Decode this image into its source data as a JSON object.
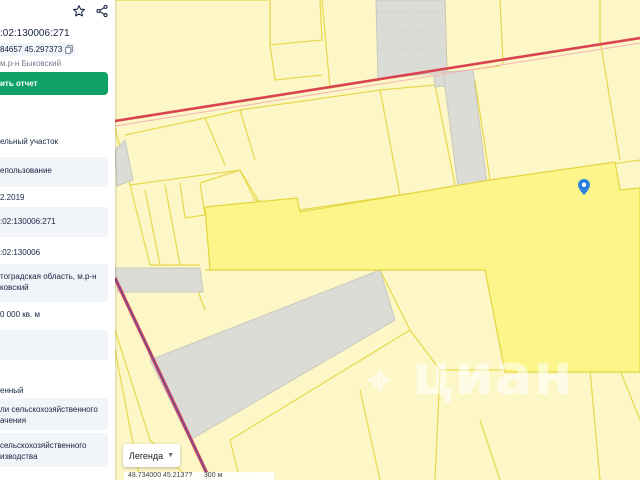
{
  "panel": {
    "title": ":02:130006:271",
    "coords": "84657 45.297373",
    "district": "м.р-н Быковский",
    "report_button": "ить отчет",
    "rows": [
      {
        "lines": [
          "ельный участок"
        ]
      },
      {
        "lines": [
          "епользование"
        ]
      },
      {
        "lines": [
          "2.2019"
        ]
      },
      {
        "lines": [
          ":02:130006:271"
        ]
      },
      {
        "lines": [
          ":02:130006"
        ]
      },
      {
        "lines": [
          "тоградская область, м.р-н",
          "ковский"
        ]
      },
      {
        "lines": [
          "0 000 кв. м"
        ]
      },
      {
        "lines": [
          ""
        ]
      },
      {
        "lines": [
          "енный"
        ]
      },
      {
        "lines": [
          "ли сельскохозяйственного",
          "ачения"
        ]
      },
      {
        "lines": [
          "сельскохозяйственного",
          "изводства"
        ]
      }
    ],
    "icons": [
      "star-icon",
      "share-icon",
      "copy-icon"
    ]
  },
  "map": {
    "legend_label": "Легенда",
    "coord_readout": "48.734000  45.2137?",
    "scale_label": "300 м",
    "watermark": "циан",
    "colors": {
      "background": "#fdf6c7",
      "parcel_fill": "#fdf6c7",
      "parcel_border": "#e6d94a",
      "selected_parcel": "#fbf58a",
      "gray_parcel": "#dcdcd6",
      "road_red": "#d9434f",
      "road_purple": "#6a4fa3",
      "pin": "#2a7fdb"
    },
    "icons": [
      "location-pin-icon",
      "chevron-down-icon"
    ]
  }
}
